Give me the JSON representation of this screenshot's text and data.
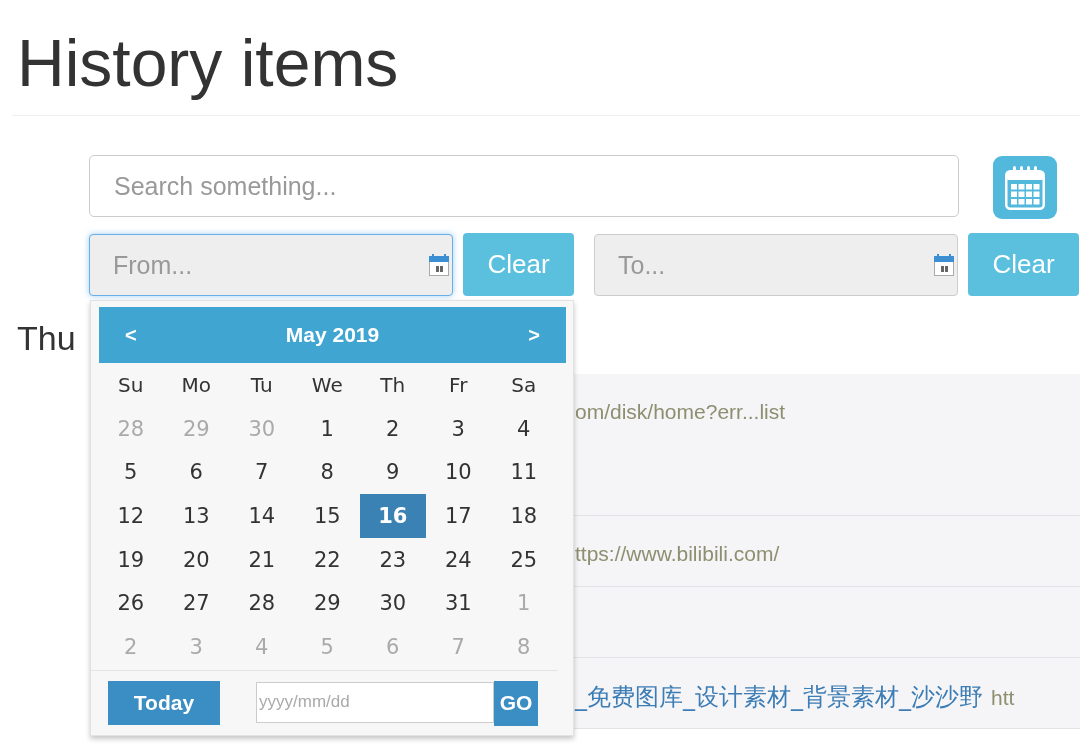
{
  "page": {
    "title": "History items"
  },
  "search": {
    "placeholder": "Search something..."
  },
  "date_filters": [
    {
      "placeholder": "From...",
      "focused": true,
      "clear_label": "Clear",
      "picker": {
        "prev": "<",
        "month": "May 2019",
        "next": ">",
        "weekdays": [
          "Su",
          "Mo",
          "Tu",
          "We",
          "Th",
          "Fr",
          "Sa"
        ],
        "weeks": [
          [
            {
              "day": "28",
              "other_month": true,
              "selected": false
            },
            {
              "day": "29",
              "other_month": true,
              "selected": false
            },
            {
              "day": "30",
              "other_month": true,
              "selected": false
            },
            {
              "day": "1",
              "other_month": false,
              "selected": false
            },
            {
              "day": "2",
              "other_month": false,
              "selected": false
            },
            {
              "day": "3",
              "other_month": false,
              "selected": false
            },
            {
              "day": "4",
              "other_month": false,
              "selected": false
            }
          ],
          [
            {
              "day": "5",
              "other_month": false,
              "selected": false
            },
            {
              "day": "6",
              "other_month": false,
              "selected": false
            },
            {
              "day": "7",
              "other_month": false,
              "selected": false
            },
            {
              "day": "8",
              "other_month": false,
              "selected": false
            },
            {
              "day": "9",
              "other_month": false,
              "selected": false
            },
            {
              "day": "10",
              "other_month": false,
              "selected": false
            },
            {
              "day": "11",
              "other_month": false,
              "selected": false
            }
          ],
          [
            {
              "day": "12",
              "other_month": false,
              "selected": false
            },
            {
              "day": "13",
              "other_month": false,
              "selected": false
            },
            {
              "day": "14",
              "other_month": false,
              "selected": false
            },
            {
              "day": "15",
              "other_month": false,
              "selected": false
            },
            {
              "day": "16",
              "other_month": false,
              "selected": true
            },
            {
              "day": "17",
              "other_month": false,
              "selected": false
            },
            {
              "day": "18",
              "other_month": false,
              "selected": false
            }
          ],
          [
            {
              "day": "19",
              "other_month": false,
              "selected": false
            },
            {
              "day": "20",
              "other_month": false,
              "selected": false
            },
            {
              "day": "21",
              "other_month": false,
              "selected": false
            },
            {
              "day": "22",
              "other_month": false,
              "selected": false
            },
            {
              "day": "23",
              "other_month": false,
              "selected": false
            },
            {
              "day": "24",
              "other_month": false,
              "selected": false
            },
            {
              "day": "25",
              "other_month": false,
              "selected": false
            }
          ],
          [
            {
              "day": "26",
              "other_month": false,
              "selected": false
            },
            {
              "day": "27",
              "other_month": false,
              "selected": false
            },
            {
              "day": "28",
              "other_month": false,
              "selected": false
            },
            {
              "day": "29",
              "other_month": false,
              "selected": false
            },
            {
              "day": "30",
              "other_month": false,
              "selected": false
            },
            {
              "day": "31",
              "other_month": false,
              "selected": false
            },
            {
              "day": "1",
              "other_month": true,
              "selected": false
            }
          ],
          [
            {
              "day": "2",
              "other_month": true,
              "selected": false
            },
            {
              "day": "3",
              "other_month": true,
              "selected": false
            },
            {
              "day": "4",
              "other_month": true,
              "selected": false
            },
            {
              "day": "5",
              "other_month": true,
              "selected": false
            },
            {
              "day": "6",
              "other_month": true,
              "selected": false
            },
            {
              "day": "7",
              "other_month": true,
              "selected": false
            },
            {
              "day": "8",
              "other_month": true,
              "selected": false
            }
          ]
        ],
        "today": "Today",
        "input_placeholder": "yyyy/mm/dd",
        "go": "GO"
      }
    },
    {
      "placeholder": "To...",
      "focused": false,
      "clear_label": "Clear"
    }
  ],
  "day_heading": "Thu",
  "history": [
    {
      "kind": "url",
      "url": "om/disk/home?err...list"
    },
    {
      "kind": "url",
      "url": "ttps://www.bilibili.com/"
    },
    {
      "kind": "empty"
    },
    {
      "kind": "title_url",
      "title": "_免费图库_设计素材_背景素材_沙沙野",
      "url": "htt"
    }
  ]
}
